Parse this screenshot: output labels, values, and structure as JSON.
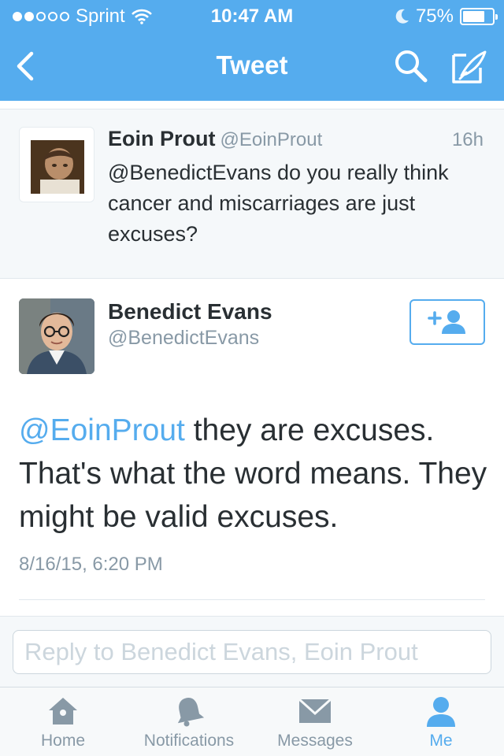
{
  "status_bar": {
    "carrier": "Sprint",
    "time": "10:47 AM",
    "battery": "75%",
    "battery_level": 0.75
  },
  "nav": {
    "title": "Tweet",
    "icons": [
      "back-icon",
      "search-icon",
      "compose-icon"
    ]
  },
  "parent_tweet": {
    "name": "Eoin Prout",
    "handle": "@EoinProut",
    "age": "16h",
    "text": "@BenedictEvans do you really think cancer and miscarriages are just excuses?"
  },
  "main_tweet": {
    "name": "Benedict Evans",
    "handle": "@BenedictEvans",
    "mention": "@EoinProut",
    "text": " they are excuses. That's what the word means. They might be valid excuses.",
    "date": "8/16/15, 6:20 PM"
  },
  "reply": {
    "placeholder": "Reply to Benedict Evans, Eoin Prout"
  },
  "tabbar": {
    "items": [
      {
        "label": "Home",
        "icon": "home-icon"
      },
      {
        "label": "Notifications",
        "icon": "bell-icon"
      },
      {
        "label": "Messages",
        "icon": "envelope-icon"
      },
      {
        "label": "Me",
        "icon": "person-icon"
      }
    ],
    "active": "Me"
  },
  "colors": {
    "brand": "#55acee",
    "text": "#292f33",
    "muted": "#8899a6",
    "background_alt": "#f5f8fa"
  }
}
